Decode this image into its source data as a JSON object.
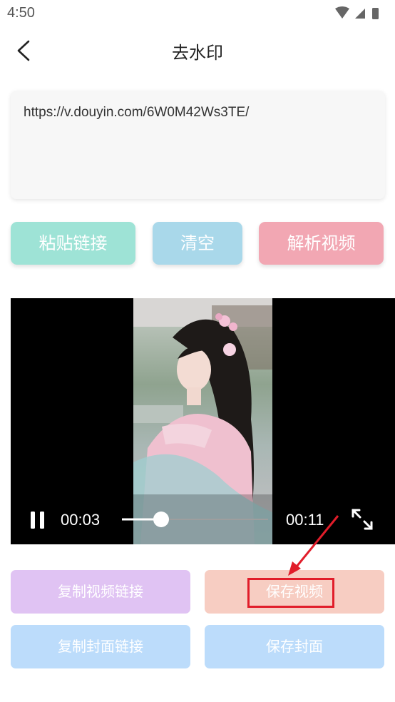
{
  "status_bar": {
    "time": "4:50"
  },
  "header": {
    "title": "去水印"
  },
  "url_input": {
    "value": "https://v.douyin.com/6W0M42Ws3TE/"
  },
  "actions": {
    "paste": "粘贴链接",
    "clear": "清空",
    "parse": "解析视频"
  },
  "player": {
    "current_time": "00:03",
    "duration": "00:11",
    "progress_fraction": 0.27
  },
  "bottom_actions": {
    "copy_video_link": "复制视频链接",
    "save_video": "保存视频",
    "copy_cover_link": "复制封面链接",
    "save_cover": "保存封面"
  },
  "colors": {
    "paste_btn": "#9ee3d6",
    "clear_btn": "#a9d8ea",
    "parse_btn": "#f2a7b3",
    "copy_video_btn": "#e0c3f3",
    "save_video_btn": "#f7cdc2",
    "cover_btn": "#bcdcfb",
    "annotation": "#e11d2a"
  }
}
